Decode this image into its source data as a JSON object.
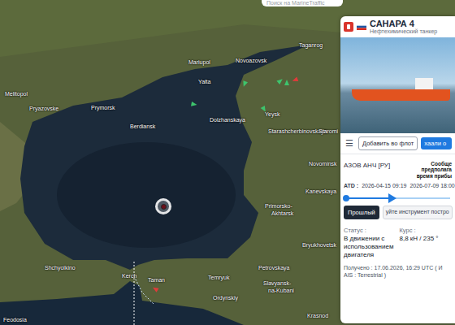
{
  "search": {
    "placeholder": "Поиск на MarineTraffic"
  },
  "map": {
    "places": [
      "Melitopol",
      "Pryazovske",
      "Prymorsk",
      "Berdiansk",
      "Mariupol",
      "Yalta",
      "Novoazovsk",
      "Taganrog",
      "Dolzhanskaya",
      "Yeysk",
      "Starashcherbinovskaya",
      "Staromi",
      "Novominsk",
      "Primorsko-",
      "Akhtarsk",
      "Kanevskaya",
      "Bryukhovetsk",
      "Petrovskaya",
      "Slavyansk-",
      "na-Kubani",
      "Temryuk",
      "Taman",
      "Kerch",
      "Shchyolkino",
      "Ordynskiy",
      "Feodosia",
      "Krasnod"
    ],
    "ship_markers": [
      {
        "color": "#3ec46d"
      },
      {
        "color": "#3ec46d"
      },
      {
        "color": "#3ec46d"
      },
      {
        "color": "#3ec46d"
      },
      {
        "color": "#3ec46d"
      },
      {
        "color": "#e03b3b"
      },
      {
        "color": "#e03b3b"
      }
    ]
  },
  "vessel": {
    "name": "САНАРА 4",
    "type": "Нефтехимический танкер",
    "menu_icon": "☰",
    "add_fleet": "Добавить во флот",
    "alert_button": "хаали о",
    "destination": "АЗОВ АНЧ [РУ]",
    "eta_label": [
      "Сообще",
      "предполага",
      "время прибы"
    ],
    "atd_label": "ATD :",
    "atd": "2026-04-15 09:19",
    "eta": "2026-07-09 18:00",
    "progress": {
      "level": 0.45
    },
    "past_button": "Прошлый",
    "tooltip": "уйте инструмент постро",
    "status_label": "Статус :",
    "status": "В движении с использованием двигателя",
    "course_label": "Курс :",
    "course": "8,8 кН / 235 °",
    "received": "Получено : 17.06.2026, 16:29 UTC ( И",
    "ais": "AIS : Terrestrial )"
  }
}
